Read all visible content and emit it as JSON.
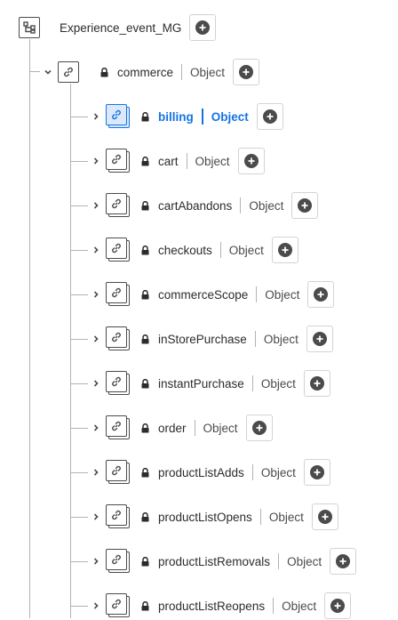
{
  "root": {
    "name": "Experience_event_MG",
    "icon": "schema-tree-icon"
  },
  "commerce": {
    "name": "commerce",
    "type": "Object"
  },
  "children": [
    {
      "name": "billing",
      "type": "Object",
      "selected": true
    },
    {
      "name": "cart",
      "type": "Object"
    },
    {
      "name": "cartAbandons",
      "type": "Object"
    },
    {
      "name": "checkouts",
      "type": "Object"
    },
    {
      "name": "commerceScope",
      "type": "Object"
    },
    {
      "name": "inStorePurchase",
      "type": "Object"
    },
    {
      "name": "instantPurchase",
      "type": "Object"
    },
    {
      "name": "order",
      "type": "Object"
    },
    {
      "name": "productListAdds",
      "type": "Object"
    },
    {
      "name": "productListOpens",
      "type": "Object"
    },
    {
      "name": "productListRemovals",
      "type": "Object"
    },
    {
      "name": "productListReopens",
      "type": "Object"
    }
  ],
  "colors": {
    "accent": "#1473e6",
    "text": "#2c2c2c",
    "line": "#b3b3b3"
  }
}
